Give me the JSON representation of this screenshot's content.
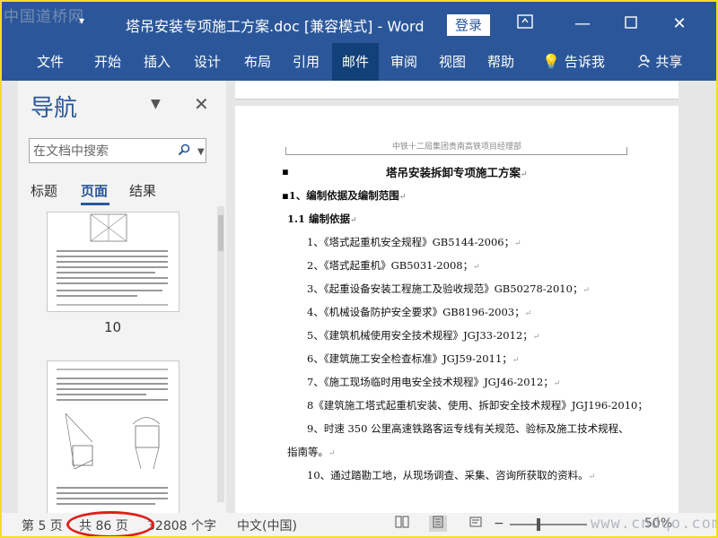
{
  "watermark_top": "中国道桥网",
  "watermark_bottom": "www.cndqo.com",
  "titlebar": {
    "title": "塔吊安装专项施工方案.doc [兼容模式] - Word",
    "login_label": "登录"
  },
  "ribbon": {
    "tabs": [
      "文件",
      "开始",
      "插入",
      "设计",
      "布局",
      "引用",
      "邮件",
      "审阅",
      "视图",
      "帮助"
    ],
    "active_tab": "邮件",
    "tell_me": "告诉我",
    "share": "共享"
  },
  "nav_pane": {
    "title": "导航",
    "search_placeholder": "在文档中搜索",
    "tabs": [
      "标题",
      "页面",
      "结果"
    ],
    "active_tab": "页面",
    "thumbnail_page_number": "10"
  },
  "document": {
    "header": "中铁十二局集团贵南高铁项目经理部",
    "title": "塔吊安装拆卸专项施工方案",
    "section1": "1、编制依据及编制范围",
    "subsection": "1.1 编制依据",
    "items": [
      "1、《塔式起重机安全规程》GB5144-2006；",
      "2、《塔式起重机》GB5031-2008；",
      "3、《起重设备安装工程施工及验收规范》GB50278-2010；",
      "4、《机械设备防护安全要求》GB8196-2003；",
      "5、《建筑机械使用安全技术规程》JGJ33-2012；",
      "6、《建筑施工安全检查标准》JGJ59-2011；",
      "7、《施工现场临时用电安全技术规程》JGJ46-2012；",
      "8《建筑施工塔式起重机安装、使用、拆卸安全技术规程》JGJ196-2010；",
      "9、时速 350 公里高速铁路客运专线有关规范、验标及施工技术规程、",
      "指南等。",
      "10、通过踏勘工地，从现场调查、采集、咨询所获取的资料。"
    ]
  },
  "statusbar": {
    "page": "第 5 页",
    "total": "共 86 页",
    "words": "32808 个字",
    "language": "中文(中国)",
    "zoom": "50%"
  }
}
